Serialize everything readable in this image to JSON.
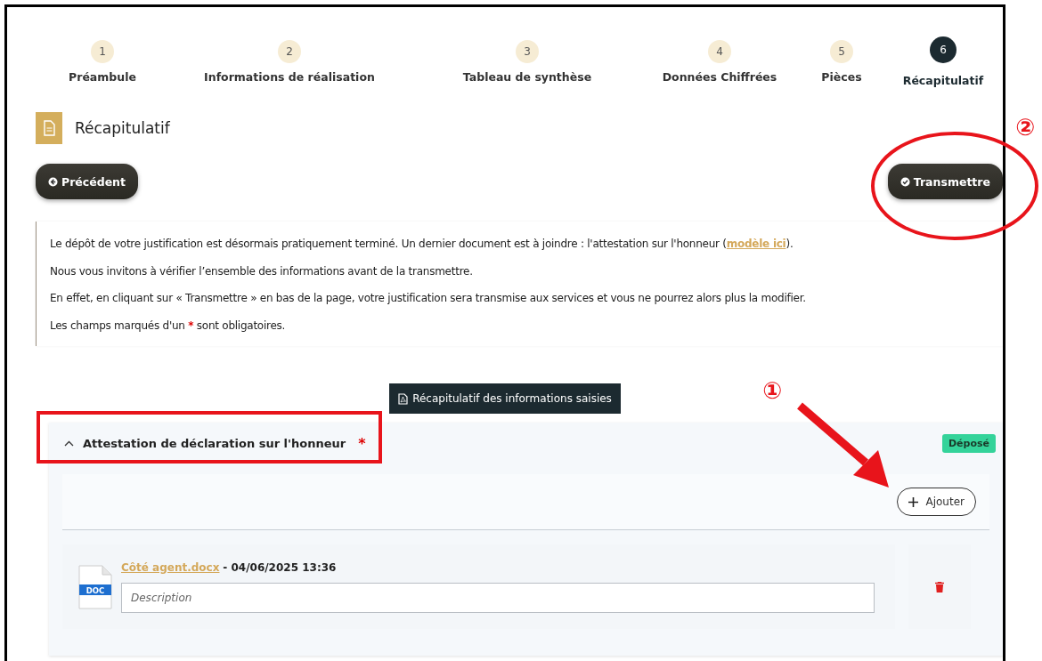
{
  "steps": [
    {
      "number": "1",
      "label": "Préambule",
      "selected": false
    },
    {
      "number": "2",
      "label": "Informations de réalisation",
      "selected": false
    },
    {
      "number": "3",
      "label": "Tableau de synthèse",
      "selected": false
    },
    {
      "number": "4",
      "label": "Données Chiffrées",
      "selected": false
    },
    {
      "number": "5",
      "label": "Pièces",
      "selected": false
    },
    {
      "number": "6",
      "label": "Récapitulatif",
      "selected": true
    }
  ],
  "page_title": "Récapitulatif",
  "buttons": {
    "previous": "Précédent",
    "submit": "Transmettre"
  },
  "notice": [
    {
      "text": "Le dépôt de votre justification est désormais pratiquement terminé. Un dernier document est à joindre : l'attestation sur l'honneur (",
      "link": "modèle ici",
      "text_after": ")."
    },
    {
      "text": "Nous vous invitons à vérifier l’ensemble des informations avant de la transmettre."
    },
    {
      "text": "En effet, en cliquant sur « Transmettre » en bas de la page, votre justification sera transmise aux services et vous ne pourrez alors plus la modifier."
    },
    {
      "text": "Les champs marqués d'un ",
      "required_mark": "*",
      "text_after": " sont obligatoires."
    }
  ],
  "summary_button": "Récapitulatif des informations saisies",
  "section": {
    "title": "Attestation de déclaration sur l'honneur",
    "required_mark": "*",
    "expanded": true,
    "status": "Déposé",
    "add_button": "Ajouter",
    "files": [
      {
        "name": "Côté agent.docx",
        "date": "- 04/06/2025 13:36",
        "type_label": "DOC",
        "placeholder": "Description"
      }
    ]
  },
  "annotations": [
    {
      "kind": "number",
      "text": "②"
    },
    {
      "kind": "ellipse"
    },
    {
      "kind": "rectangle"
    },
    {
      "kind": "number",
      "text": "①"
    },
    {
      "kind": "arrow"
    }
  ]
}
